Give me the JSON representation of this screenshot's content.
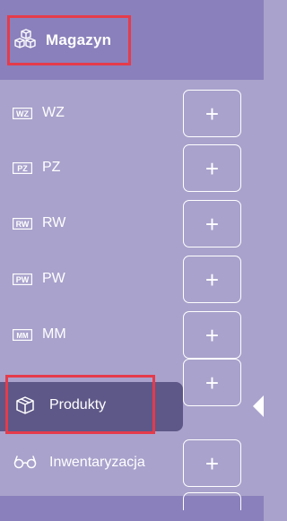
{
  "header": {
    "label": "Magazyn",
    "icon": "boxes-icon"
  },
  "items": [
    {
      "id": "wz",
      "label": "WZ",
      "icon": "wz-doc-icon",
      "badge": "WZ"
    },
    {
      "id": "pz",
      "label": "PZ",
      "icon": "pz-doc-icon",
      "badge": "PZ"
    },
    {
      "id": "rw",
      "label": "RW",
      "icon": "rw-doc-icon",
      "badge": "RW"
    },
    {
      "id": "pw",
      "label": "PW",
      "icon": "pw-doc-icon",
      "badge": "PW"
    },
    {
      "id": "mm",
      "label": "MM",
      "icon": "mm-doc-icon",
      "badge": "MM"
    },
    {
      "id": "produkty",
      "label": "Produkty",
      "icon": "box-icon",
      "active": true
    },
    {
      "id": "inwentaryzacja",
      "label": "Inwentaryzacja",
      "icon": "glasses-icon"
    }
  ],
  "add_label": "+",
  "colors": {
    "panel": "#a9a2cc",
    "header": "#8a80bb",
    "active": "#5e5888",
    "highlight": "#e53b4b"
  }
}
